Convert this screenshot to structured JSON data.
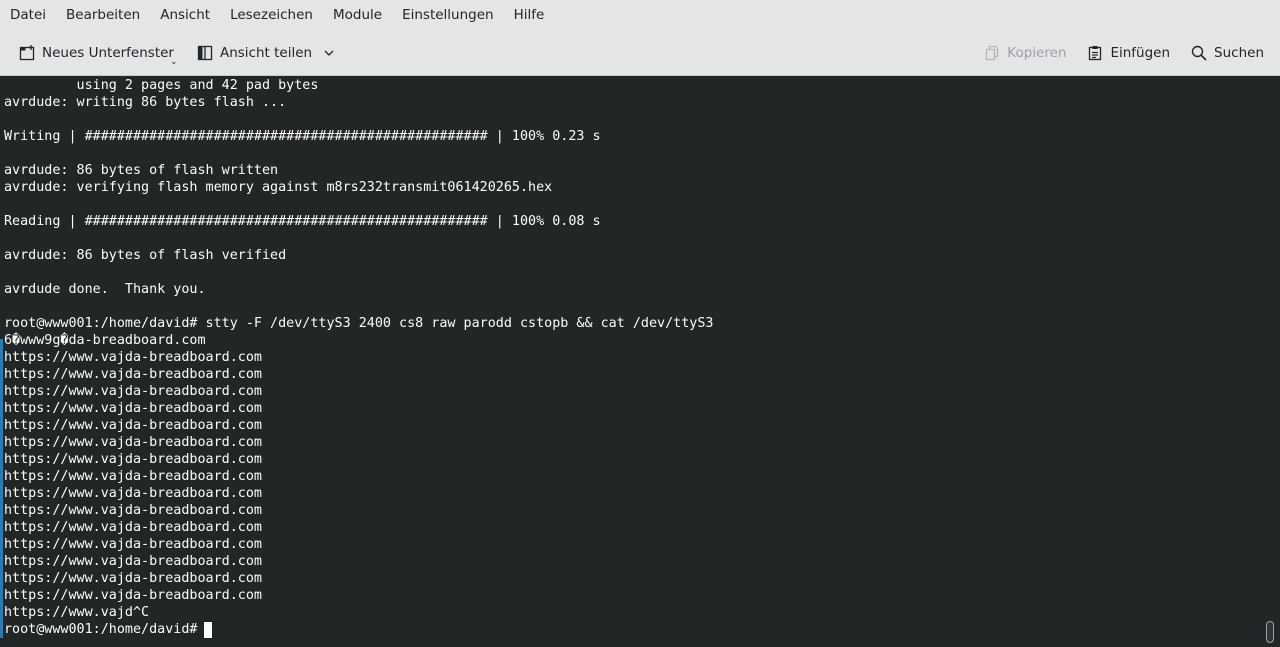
{
  "menubar": {
    "items": [
      "Datei",
      "Bearbeiten",
      "Ansicht",
      "Lesezeichen",
      "Module",
      "Einstellungen",
      "Hilfe"
    ]
  },
  "toolbar": {
    "new_tab_label": "Neues Unterfenster",
    "split_view_label": "Ansicht teilen",
    "copy_label": "Kopieren",
    "paste_label": "Einfügen",
    "search_label": "Suchen",
    "new_tab_icon": "new-tab-icon",
    "split_view_icon": "split-view-icon",
    "copy_icon": "copy-icon",
    "paste_icon": "paste-icon",
    "search_icon": "search-icon"
  },
  "terminal": {
    "lines": [
      "         using 2 pages and 42 pad bytes",
      "avrdude: writing 86 bytes flash ...",
      "",
      "Writing | ################################################## | 100% 0.23 s",
      "",
      "avrdude: 86 bytes of flash written",
      "avrdude: verifying flash memory against m8rs232transmit061420265.hex",
      "",
      "Reading | ################################################## | 100% 0.08 s",
      "",
      "avrdude: 86 bytes of flash verified",
      "",
      "avrdude done.  Thank you.",
      "",
      "root@www001:/home/david# stty -F /dev/ttyS3 2400 cs8 raw parodd cstopb && cat /dev/ttyS3",
      "6�www9g�da-breadboard.com",
      "https://www.vajda-breadboard.com",
      "https://www.vajda-breadboard.com",
      "https://www.vajda-breadboard.com",
      "https://www.vajda-breadboard.com",
      "https://www.vajda-breadboard.com",
      "https://www.vajda-breadboard.com",
      "https://www.vajda-breadboard.com",
      "https://www.vajda-breadboard.com",
      "https://www.vajda-breadboard.com",
      "https://www.vajda-breadboard.com",
      "https://www.vajda-breadboard.com",
      "https://www.vajda-breadboard.com",
      "https://www.vajda-breadboard.com",
      "https://www.vajda-breadboard.com",
      "https://www.vajda-breadboard.com",
      "https://www.vajd^C",
      "root@www001:/home/david# "
    ],
    "colors": {
      "background": "#232627",
      "foreground": "#fcfcfc",
      "marker": "#2a7ab5"
    }
  }
}
